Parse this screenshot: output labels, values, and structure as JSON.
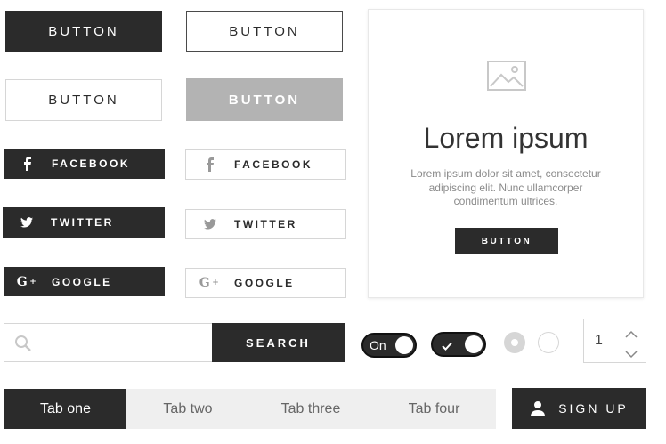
{
  "buttons": {
    "dark": "BUTTON",
    "outline": "BUTTON",
    "outline_light": "BUTTON",
    "disabled": "BUTTON"
  },
  "social": {
    "facebook": "FACEBOOK",
    "twitter": "TWITTER",
    "google": "GOOGLE"
  },
  "card": {
    "title": "Lorem ipsum",
    "body": "Lorem ipsum dolor sit amet, consectetur adipiscing elit. Nunc ullamcorper condimentum ultrices.",
    "button": "BUTTON"
  },
  "search": {
    "placeholder": "",
    "button": "SEARCH"
  },
  "toggles": {
    "on_label": "On"
  },
  "stepper": {
    "value": "1"
  },
  "tabs": [
    {
      "label": "Tab one"
    },
    {
      "label": "Tab two"
    },
    {
      "label": "Tab three"
    },
    {
      "label": "Tab four"
    }
  ],
  "signup": {
    "label": "SIGN UP"
  },
  "colors": {
    "dark": "#2b2b2b",
    "disabled": "#b3b3b3",
    "tab_bar": "#efefef"
  },
  "icons": [
    "facebook-icon",
    "twitter-icon",
    "google-plus-icon",
    "image-placeholder-icon",
    "search-icon",
    "check-icon",
    "user-icon",
    "chevron-up-icon",
    "chevron-down-icon"
  ]
}
